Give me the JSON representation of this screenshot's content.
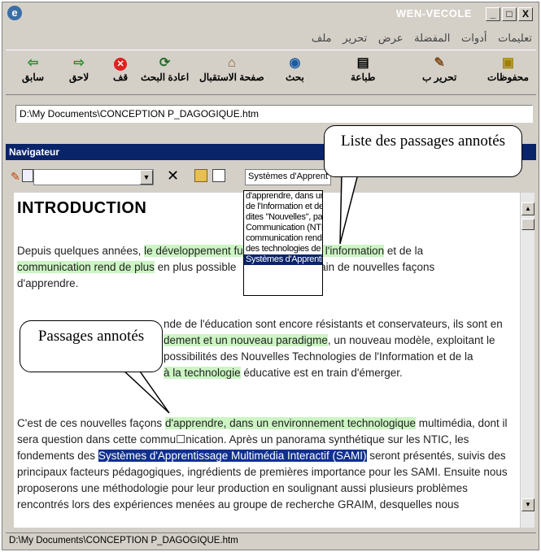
{
  "window": {
    "title": "WEN-VECOLE",
    "buttons": [
      "_",
      "□",
      "X"
    ]
  },
  "menu": [
    "ملف",
    "تحرير",
    "عرض",
    "المفضلة",
    "أدوات",
    "تعليمات"
  ],
  "toolbar": {
    "back": "سابق",
    "forward": "لاحق",
    "stop": "قف",
    "refresh": "اعادة البحث",
    "home": "صفحة الاستقبال",
    "search": "بحث",
    "print": "طباعة",
    "edit": "تحرير ب",
    "favorites": "محفوظات"
  },
  "address": "D:\\My Documents\\CONCEPTION P_DAGOGIQUE.htm",
  "navigator": {
    "title": "Navigateur",
    "passage_combo": "Systèmes d'Apprent",
    "passages": [
      "d'apprendre, dans un",
      "de l'Information et de",
      "dites \"Nouvelles\", par",
      "Communication (NTIC",
      "communication rend c",
      "des technologies de l'",
      "Systèmes d'Apprentis"
    ]
  },
  "document": {
    "heading": "INTRODUCTION",
    "p1": {
      "a": "Depuis quelques années, ",
      "b": "le développement fu",
      "c": "gies de l'information",
      "d": " et de la ",
      "e": "communication rend de plus",
      "f": " en plus possible",
      "g": "umain de nouvelles façons",
      "h": "d'apprendre."
    },
    "p2": {
      "line1": "nde de l'éducation sont encore résistants et conservateurs, ils sont en",
      "line2a": "dement et un nouveau paradigme",
      "line2b": ", un nouveau modèle, exploitant le",
      "line3": "possibilités des Nouvelles Technologies de l'Information et de la",
      "line4a": "à la technologie",
      "line4b": " éducative est en train d'émerger."
    },
    "p3": {
      "a": "C'est de ces nouvelles façons ",
      "b": "d'apprendre, dans un environnement technologique",
      "c": " multimédia, dont il",
      "d": "sera question dans cette commu☐nication. Après un panorama synthétique sur les NTIC, les",
      "e": "fondements des ",
      "f": "Systèmes d'Apprentissage Multimédia Interactif (SAMI)",
      "g": " seront présentés, suivis des",
      "h": "principaux facteurs pédagogiques, ingrédients de premières importance pour les SAMI. Ensuite nous",
      "i": "proposerons une méthodologie pour leur production en soulignant aussi plusieurs problèmes",
      "j": "rencontrés lors des expériences menées au groupe de recherche GRAIM, desquelles nous"
    }
  },
  "status": "D:\\My Documents\\CONCEPTION P_DAGOGIQUE.htm",
  "callouts": {
    "list": "Liste des passages annotés",
    "passages": "Passages annotés"
  }
}
